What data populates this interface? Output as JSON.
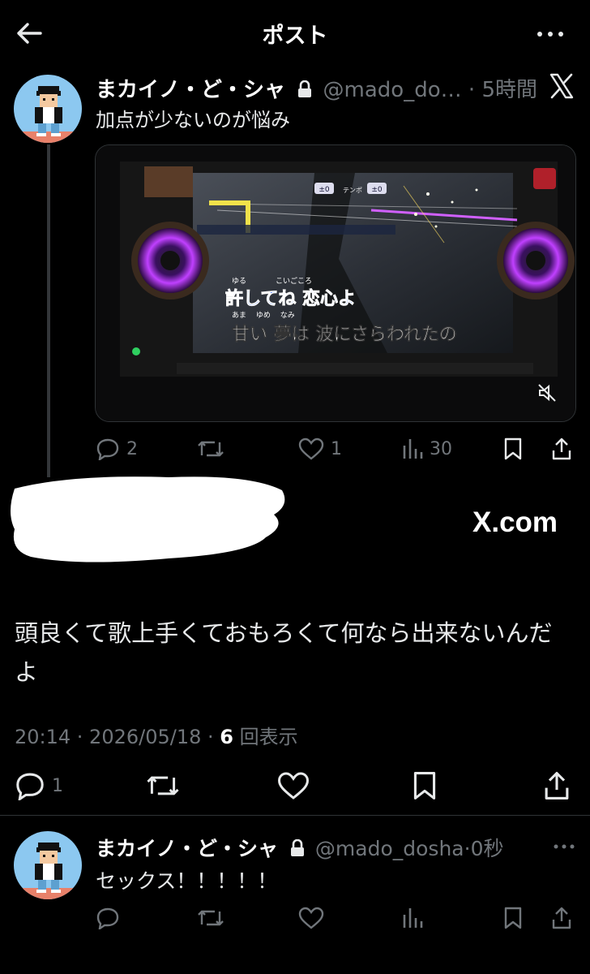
{
  "header": {
    "title": "ポスト"
  },
  "post": {
    "display_name": "まカイノ・ど・シャ",
    "handle": "@mado_do…",
    "time": "5時間",
    "text": "加点が少ないのが悩み",
    "media": {
      "lyrics_line1": "許してね 恋心よ",
      "furigana_line1": "ゆる　　　　こいごころ",
      "lyrics_line2": "甘い 夢は 波にさらわれたの",
      "furigana_line2": "あま　 ゆめ　 なみ",
      "tempo_label": "テンポ",
      "key_value": "±0",
      "tempo_value": "±0"
    },
    "stats": {
      "replies": "2",
      "retweets": "",
      "likes": "1",
      "views": "30"
    }
  },
  "quote": {
    "source": "X.com",
    "text": "頭良くて歌上手くておもろくて何なら出来ないんだよ",
    "timestamp": "20:14 · 2026/05/18 · ",
    "views_count": "6",
    "views_label": "回表示",
    "stats": {
      "replies": "1"
    }
  },
  "reply": {
    "display_name": "まカイノ・ど・シャ",
    "handle": "@mado_dosha",
    "time": "0秒",
    "text": "セックス！！！！！"
  },
  "colors": {
    "background": "#000000",
    "muted": "#71767b",
    "text": "#e7e9ea",
    "divider": "#2f3336"
  }
}
